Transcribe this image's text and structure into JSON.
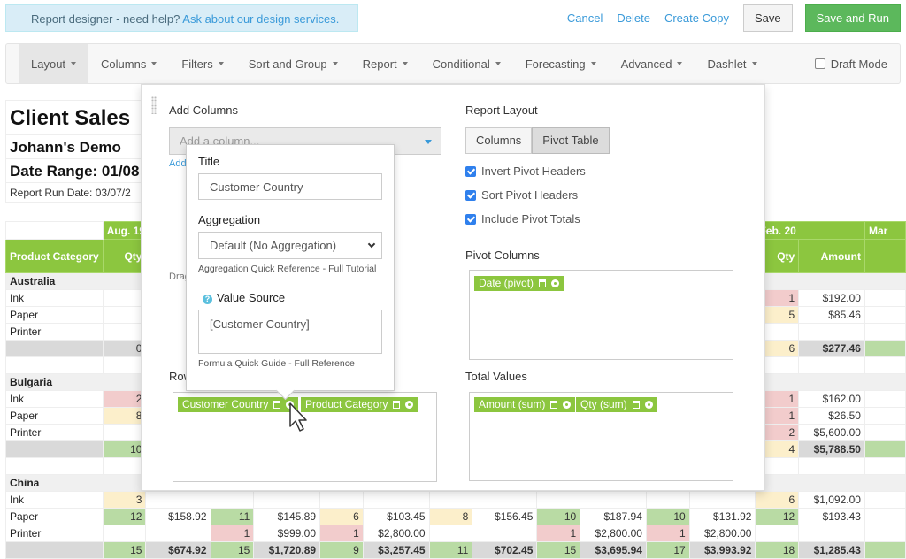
{
  "help_banner": {
    "text": "Report designer - need help?",
    "link": "Ask about our design services."
  },
  "top_actions": {
    "cancel": "Cancel",
    "delete": "Delete",
    "create_copy": "Create Copy",
    "save": "Save",
    "save_and_run": "Save and Run"
  },
  "toolbar": {
    "items": [
      "Layout",
      "Columns",
      "Filters",
      "Sort and Group",
      "Report",
      "Conditional",
      "Forecasting",
      "Advanced",
      "Dashlet"
    ],
    "active": "Layout",
    "draft_mode_label": "Draft Mode",
    "draft_mode_checked": false
  },
  "report": {
    "title": "Client Sales",
    "subtitle": "Johann's Demo",
    "date_range": "Date Range: 01/08",
    "run_date": "Report Run Date: 03/07/2"
  },
  "layout_panel": {
    "add_columns_heading": "Add Columns",
    "add_column_placeholder": "Add a column...",
    "add_link": "Add",
    "drag_hint": "Drag",
    "rows_heading": "Rows",
    "report_layout_heading": "Report Layout",
    "layout_options": [
      "Columns",
      "Pivot Table"
    ],
    "layout_selected": "Pivot Table",
    "checkboxes": [
      {
        "label": "Invert Pivot Headers",
        "checked": true
      },
      {
        "label": "Sort Pivot Headers",
        "checked": true
      },
      {
        "label": "Include Pivot Totals",
        "checked": true
      }
    ],
    "pivot_columns_heading": "Pivot Columns",
    "pivot_columns": [
      "Date (pivot)"
    ],
    "total_values_heading": "Total Values",
    "total_values": [
      "Amount (sum)",
      "Qty (sum)"
    ],
    "rows": [
      "Customer Country",
      "Product Category"
    ]
  },
  "popover": {
    "title_label": "Title",
    "title_value": "Customer Country",
    "aggregation_label": "Aggregation",
    "aggregation_value": "Default (No Aggregation)",
    "aggregation_help": "Aggregation Quick Reference - Full Tutorial",
    "value_source_label": "Value Source",
    "value_source_value": "[Customer Country]",
    "formula_help": "Formula Quick Guide - Full Reference"
  },
  "pivot_table": {
    "row_header": "Product Category",
    "periods": [
      "Aug. 19",
      "",
      "",
      "",
      "",
      "",
      "Feb. 20",
      "Mar"
    ],
    "qty_label": "Qty",
    "amount_label": "Amount",
    "groups": [
      {
        "name": "Australia",
        "rows": [
          {
            "label": "Ink",
            "cells": [
              [
                "",
                ""
              ],
              [
                "",
                ""
              ],
              [
                "",
                ""
              ],
              [
                "",
                ""
              ],
              [
                "",
                ""
              ],
              [
                "",
                ""
              ],
              [
                "1",
                "$192.00"
              ]
            ]
          },
          {
            "label": "Paper",
            "cells": [
              [
                "",
                ""
              ],
              [
                "",
                ""
              ],
              [
                "",
                ""
              ],
              [
                "",
                ""
              ],
              [
                "",
                ""
              ],
              [
                "",
                ""
              ],
              [
                "5",
                "$85.46"
              ]
            ]
          },
          {
            "label": "Printer",
            "cells": [
              [
                "",
                ""
              ],
              [
                "",
                ""
              ],
              [
                "",
                ""
              ],
              [
                "",
                ""
              ],
              [
                "",
                ""
              ],
              [
                "",
                ""
              ],
              [
                "",
                ""
              ]
            ]
          }
        ],
        "total": [
          [
            "0",
            ""
          ],
          [
            "",
            ""
          ],
          [
            "",
            ""
          ],
          [
            "",
            ""
          ],
          [
            "",
            ""
          ],
          [
            "",
            ""
          ],
          [
            "6",
            "$277.46"
          ]
        ]
      },
      {
        "name": "Bulgaria",
        "rows": [
          {
            "label": "Ink",
            "cells": [
              [
                "2",
                ""
              ],
              [
                "",
                ""
              ],
              [
                "",
                ""
              ],
              [
                "",
                ""
              ],
              [
                "",
                ""
              ],
              [
                "",
                ""
              ],
              [
                "1",
                "$162.00"
              ]
            ]
          },
          {
            "label": "Paper",
            "cells": [
              [
                "8",
                ""
              ],
              [
                "",
                ""
              ],
              [
                "",
                ""
              ],
              [
                "",
                ""
              ],
              [
                "",
                ""
              ],
              [
                "",
                ""
              ],
              [
                "1",
                "$26.50"
              ]
            ]
          },
          {
            "label": "Printer",
            "cells": [
              [
                "",
                ""
              ],
              [
                "",
                ""
              ],
              [
                "",
                ""
              ],
              [
                "",
                ""
              ],
              [
                "",
                ""
              ],
              [
                "",
                ""
              ],
              [
                "2",
                "$5,600.00"
              ]
            ]
          }
        ],
        "total": [
          [
            "10",
            ""
          ],
          [
            "",
            ""
          ],
          [
            "",
            ""
          ],
          [
            "",
            ""
          ],
          [
            "",
            ""
          ],
          [
            "",
            ""
          ],
          [
            "4",
            "$5,788.50"
          ]
        ]
      },
      {
        "name": "China",
        "rows": [
          {
            "label": "Ink",
            "cells": [
              [
                "3",
                ""
              ],
              [
                "",
                ""
              ],
              [
                "",
                ""
              ],
              [
                "",
                ""
              ],
              [
                "",
                ""
              ],
              [
                "",
                ""
              ],
              [
                "6",
                "$1,092.00"
              ]
            ]
          },
          {
            "label": "Paper",
            "cells": [
              [
                "12",
                "$158.92"
              ],
              [
                "11",
                "$145.89"
              ],
              [
                "6",
                "$103.45"
              ],
              [
                "8",
                "$156.45"
              ],
              [
                "10",
                "$187.94"
              ],
              [
                "10",
                "$131.92"
              ],
              [
                "12",
                "$193.43"
              ]
            ]
          },
          {
            "label": "Printer",
            "cells": [
              [
                "",
                ""
              ],
              [
                "1",
                "$999.00"
              ],
              [
                "1",
                "$2,800.00"
              ],
              [
                "",
                ""
              ],
              [
                "1",
                "$2,800.00"
              ],
              [
                "1",
                "$2,800.00"
              ],
              [
                "",
                ""
              ]
            ]
          }
        ],
        "total": [
          [
            "15",
            "$674.92"
          ],
          [
            "15",
            "$1,720.89"
          ],
          [
            "9",
            "$3,257.45"
          ],
          [
            "11",
            "$702.45"
          ],
          [
            "15",
            "$3,695.94"
          ],
          [
            "17",
            "$3,993.92"
          ],
          [
            "18",
            "$1,285.43"
          ]
        ]
      }
    ],
    "colors": {
      "red": "#f2cccc",
      "yellow": "#fcefcb",
      "green": "#b9dba4",
      "header_green": "#8cc63f"
    }
  }
}
